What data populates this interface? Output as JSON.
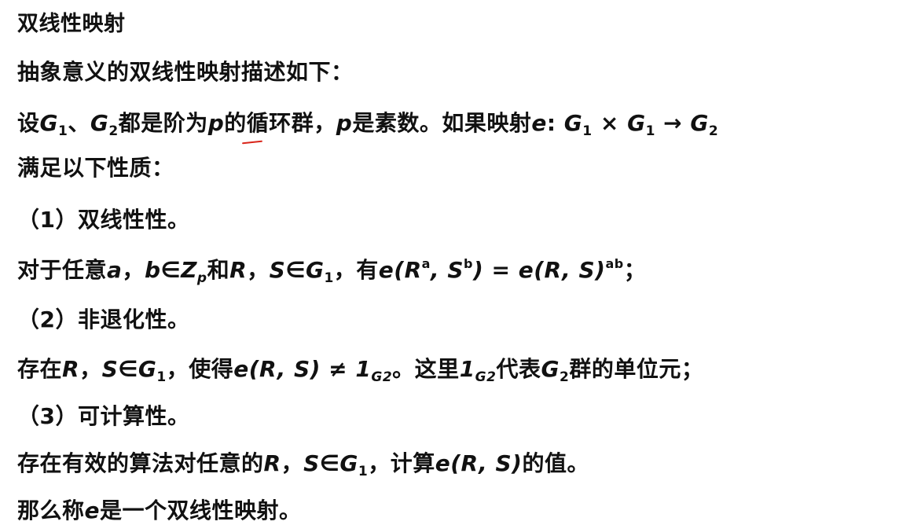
{
  "title": "双线性映射",
  "intro": "抽象意义的双线性映射描述如下：",
  "def": {
    "t1": "设",
    "G": "G",
    "one": "1",
    "sep": "、",
    "two": "2",
    "t2": "都是阶为",
    "p": "p",
    "t3": "的循环群，",
    "t4": "是素数。如果映射",
    "e": "e",
    "colon": ": ",
    "times": " × ",
    "arrow": " → "
  },
  "cond": "满足以下性质：",
  "p1": {
    "heading": "（1）双线性性。",
    "t1": "对于任意",
    "a": "a",
    "comma": "，",
    "b": "b",
    "in": "∈",
    "Z": "Z",
    "zp": "p",
    "and": "和",
    "R": "R",
    "S": "S",
    "G": "G",
    "one": "1",
    "have": "，有",
    "lhs": "e(R",
    "lhs_sup_a": "a",
    "mid": ", S",
    "lhs_sup_b": "b",
    "eq": ") = e(R, S)",
    "sup_ab": "ab",
    "end": "；"
  },
  "p2": {
    "heading": "（2）非退化性。",
    "t1": "存在",
    "R": "R",
    "comma": "，",
    "S": "S",
    "in": "∈",
    "G": "G",
    "one": "1",
    "t2": "，使得",
    "expr": "e(R, S) ≠ 1",
    "sub": "G2",
    "t3": "。这里",
    "unit": "1",
    "sub2": "G2",
    "t4": "代表",
    "G2": "G",
    "two": "2",
    "t5": "群的单位元；"
  },
  "p3": {
    "heading": "（3）可计算性。",
    "t1": "存在有效的算法对任意的",
    "R": "R",
    "comma": "，",
    "S": "S",
    "in": "∈",
    "G": "G",
    "one": "1",
    "t2": "，计算",
    "expr": "e(R, S)",
    "t3": "的值。"
  },
  "conclusion": {
    "t1": "那么称",
    "e": "e",
    "t2": "是一个双线性映射。"
  },
  "colors": {
    "text": "#111111",
    "annotation": "#d9251a"
  }
}
